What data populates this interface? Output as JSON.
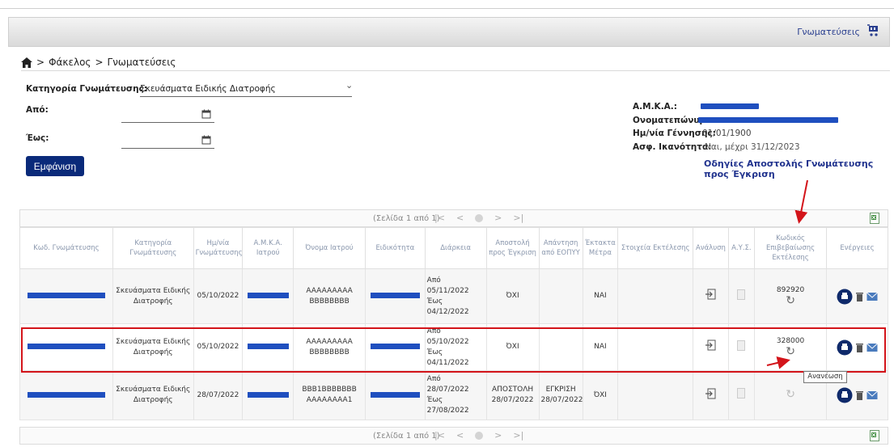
{
  "topbar": {
    "link": "Γνωματεύσεις",
    "cart_icon": "cart-icon"
  },
  "breadcrumb": {
    "home_icon": "home-icon",
    "items": [
      "Φάκελος",
      "Γνωματεύσεις"
    ],
    "separator": ">"
  },
  "filters": {
    "category_label": "Κατηγορία Γνωμάτευσης:",
    "category_value": "Σκευάσματα Ειδικής Διατροφής",
    "from_label": "Από:",
    "from_value": "",
    "to_label": "Έως:",
    "to_value": "",
    "show_button": "Εμφάνιση"
  },
  "patient": {
    "amka_label": "Α.Μ.Κ.Α.:",
    "name_label": "Ονοματεπώνυμο:",
    "dob_label": "Ημ/νία Γέννησης:",
    "dob_value": "01/01/1900",
    "insurance_label": "Ασφ. Ικανότητα:",
    "insurance_value": "Ναι, μέχρι 31/12/2023",
    "instructions_link": "Οδηγίες Αποστολής Γνωμάτευσης προς Έγκριση"
  },
  "pager": {
    "text": "(Σελίδα 1 από 1)",
    "first": "|<",
    "prev": "<",
    "next": ">",
    "last": ">|"
  },
  "table": {
    "headers": [
      "Κωδ. Γνωμάτευσης",
      "Κατηγορία Γνωμάτευσης",
      "Ημ/νία Γνωμάτευσης",
      "Α.Μ.Κ.Α. Ιατρού",
      "Όνομα Ιατρού",
      "Ειδικότητα",
      "Διάρκεια",
      "Αποστολή προς Έγκριση",
      "Απάντηση από ΕΟΠΥΥ",
      "Έκτακτα Μέτρα",
      "Στοιχεία Εκτέλεσης",
      "Ανάλυση",
      "Α.Υ.Σ.",
      "Κωδικός Επιβεβαίωσης Εκτέλεσης",
      "Ενέργειες"
    ],
    "rows": [
      {
        "category": "Σκευάσματα Ειδικής Διατροφής",
        "date": "05/10/2022",
        "doctor": "AAAAAAAAA BBBBBBBB",
        "duration": "Από 05/11/2022 Έως 04/12/2022",
        "sent": "ΌΧΙ",
        "reply": "",
        "emergency": "ΝΑΙ",
        "exec": "",
        "code": "892920"
      },
      {
        "category": "Σκευάσματα Ειδικής Διατροφής",
        "date": "05/10/2022",
        "doctor": "AAAAAAAAA BBBBBBBB",
        "duration": "Από 05/10/2022 Έως 04/11/2022",
        "sent": "ΌΧΙ",
        "reply": "",
        "emergency": "ΝΑΙ",
        "exec": "",
        "code": "328000"
      },
      {
        "category": "Σκευάσματα Ειδικής Διατροφής",
        "date": "28/07/2022",
        "doctor": "BBB1BBBBBBB AAAAAAAA1",
        "duration": "Από 28/07/2022 Έως 27/08/2022",
        "sent": "ΑΠΟΣΤΟΛΗ 28/07/2022",
        "reply": "ΕΓΚΡΙΣΗ 28/07/2022",
        "emergency": "ΌΧΙ",
        "exec": "",
        "code": ""
      }
    ]
  },
  "tooltip": "Ανανέωση",
  "colors": {
    "accent": "#0a2a7a",
    "link": "#21338e",
    "redact": "#1f4fbf",
    "highlight": "#d3141a",
    "green": "#3aa047"
  }
}
